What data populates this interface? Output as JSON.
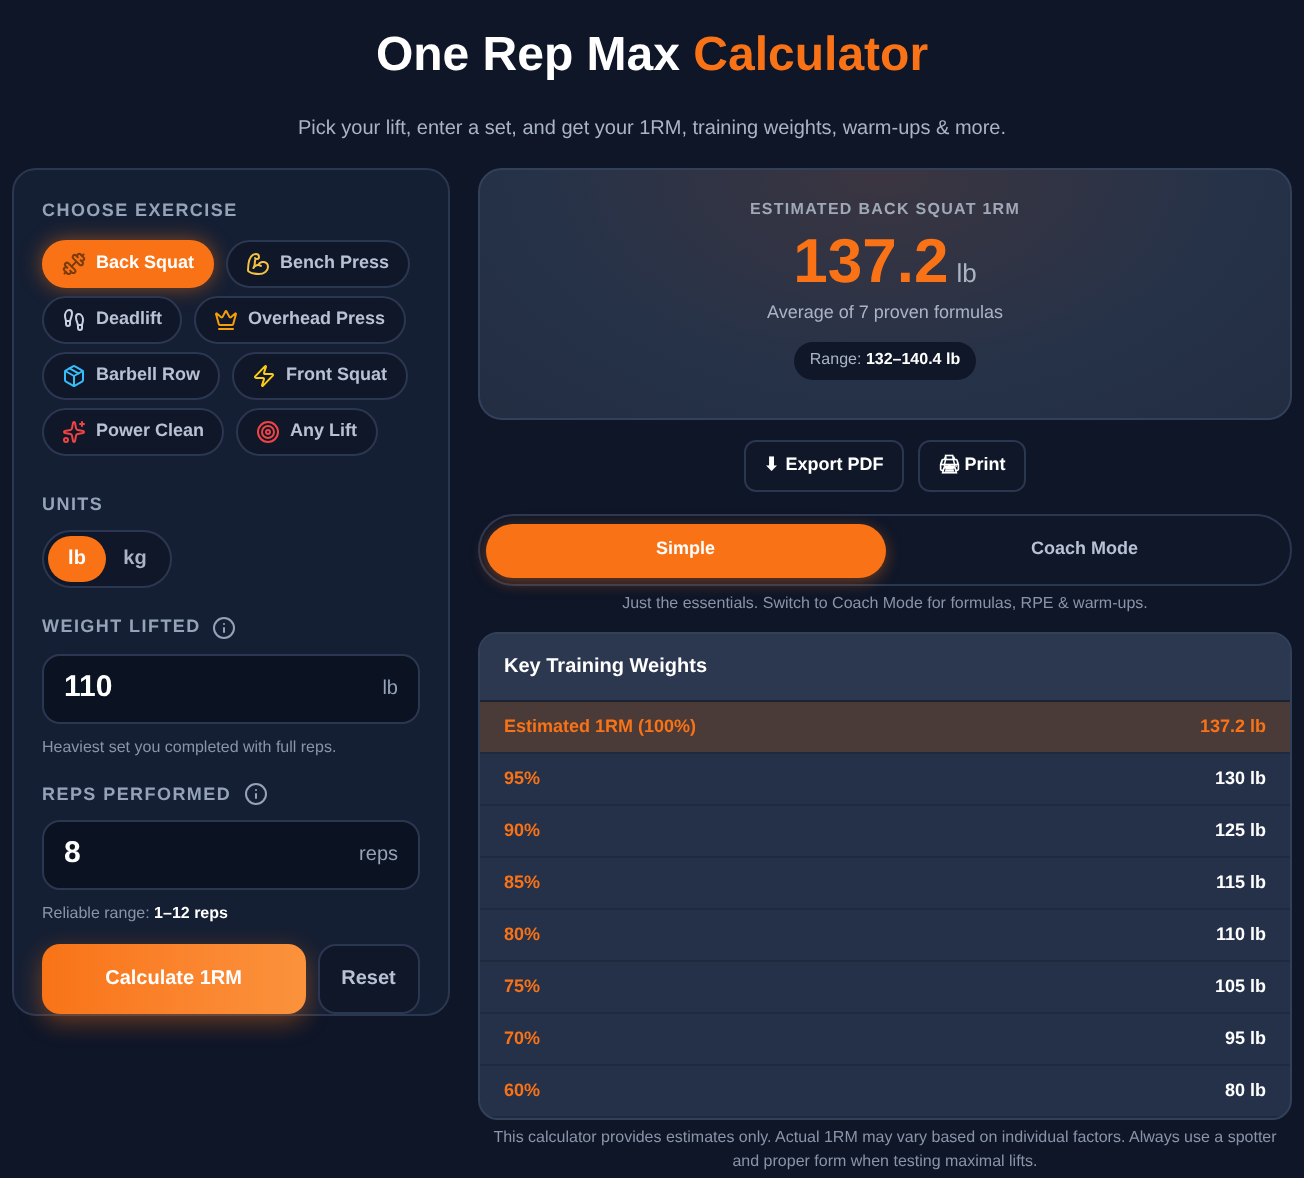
{
  "header": {
    "title_plain": "One Rep Max",
    "title_accent": "Calculator",
    "subtitle": "Pick your lift, enter a set, and get your 1RM, training weights, warm-ups & more."
  },
  "exercise": {
    "label": "CHOOSE EXERCISE",
    "options": [
      {
        "label": "Back Squat",
        "selected": true
      },
      {
        "label": "Bench Press",
        "selected": false
      },
      {
        "label": "Deadlift",
        "selected": false
      },
      {
        "label": "Overhead Press",
        "selected": false
      },
      {
        "label": "Barbell Row",
        "selected": false
      },
      {
        "label": "Front Squat",
        "selected": false
      },
      {
        "label": "Power Clean",
        "selected": false
      },
      {
        "label": "Any Lift",
        "selected": false
      }
    ]
  },
  "units": {
    "label": "UNITS",
    "options": [
      {
        "label": "lb",
        "selected": true
      },
      {
        "label": "kg",
        "selected": false
      }
    ]
  },
  "weight": {
    "label": "WEIGHT LIFTED",
    "value": "110",
    "unit": "lb",
    "hint": "Heaviest set you completed with full reps."
  },
  "reps": {
    "label": "REPS PERFORMED",
    "value": "8",
    "unit": "reps",
    "hint_prefix": "Reliable range:",
    "hint_value": "1–12 reps"
  },
  "buttons": {
    "calculate": "Calculate 1RM",
    "reset": "Reset"
  },
  "result": {
    "label": "ESTIMATED BACK SQUAT 1RM",
    "value": "137.2",
    "unit": "lb",
    "note": "Average of 7 proven formulas",
    "range_label": "Range:",
    "range_value": "132–140.4 lb"
  },
  "actions": [
    {
      "icon": "⬇",
      "label": "Export PDF"
    },
    {
      "icon": "🖨",
      "label": "Print"
    }
  ],
  "modes": [
    {
      "label": "Simple",
      "selected": true
    },
    {
      "label": "Coach Mode",
      "selected": false
    }
  ],
  "mode_hint": "Just the essentials. Switch to Coach Mode for formulas, RPE & warm-ups.",
  "weights_table": {
    "title": "Key Training Weights",
    "rows": [
      {
        "percent": "Estimated 1RM (100%)",
        "weight": "137.2 lb",
        "selected": true
      },
      {
        "percent": "95%",
        "weight": "130 lb",
        "selected": false
      },
      {
        "percent": "90%",
        "weight": "125 lb",
        "selected": false
      },
      {
        "percent": "85%",
        "weight": "115 lb",
        "selected": false
      },
      {
        "percent": "80%",
        "weight": "110 lb",
        "selected": false
      },
      {
        "percent": "75%",
        "weight": "105 lb",
        "selected": false
      },
      {
        "percent": "70%",
        "weight": "95 lb",
        "selected": false
      },
      {
        "percent": "60%",
        "weight": "80 lb",
        "selected": false
      }
    ]
  },
  "disclaimer": "This calculator provides estimates only. Actual 1RM may vary based on individual factors. Always use a spotter and proper form when testing maximal lifts."
}
